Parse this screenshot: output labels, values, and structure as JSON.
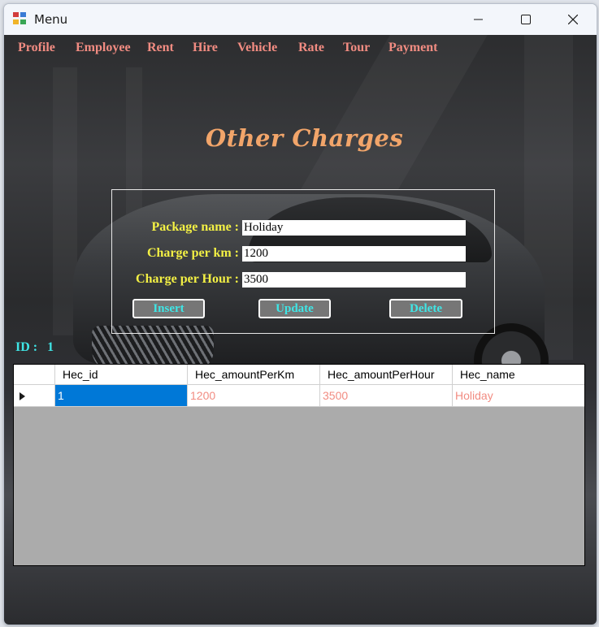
{
  "window": {
    "title": "Menu"
  },
  "menu": {
    "items": [
      "Profile",
      "Employee",
      "Rent",
      "Hire",
      "Vehicle",
      "Rate",
      "Tour",
      "Payment"
    ]
  },
  "form": {
    "heading": "Other Charges",
    "fields": [
      {
        "label": "Package name :",
        "value": "Holiday"
      },
      {
        "label": "Charge per km :",
        "value": "1200"
      },
      {
        "label": "Charge per Hour :",
        "value": "3500"
      }
    ],
    "buttons": {
      "insert": "Insert",
      "update": "Update",
      "delete": "Delete"
    },
    "id_label": "ID :",
    "id_value": "1"
  },
  "grid": {
    "columns": [
      "Hec_id",
      "Hec_amountPerKm",
      "Hec_amountPerHour",
      "Hec_name"
    ],
    "rows": [
      [
        "1",
        "1200",
        "3500",
        "Holiday"
      ]
    ],
    "selected_row_indicator": "row-pointer-icon"
  },
  "colors": {
    "menu_text": "#f28c82",
    "label_text": "#f3f044",
    "button_text": "#3fe6e6",
    "heading_text": "#f2a56a",
    "selection": "#0078d7"
  }
}
